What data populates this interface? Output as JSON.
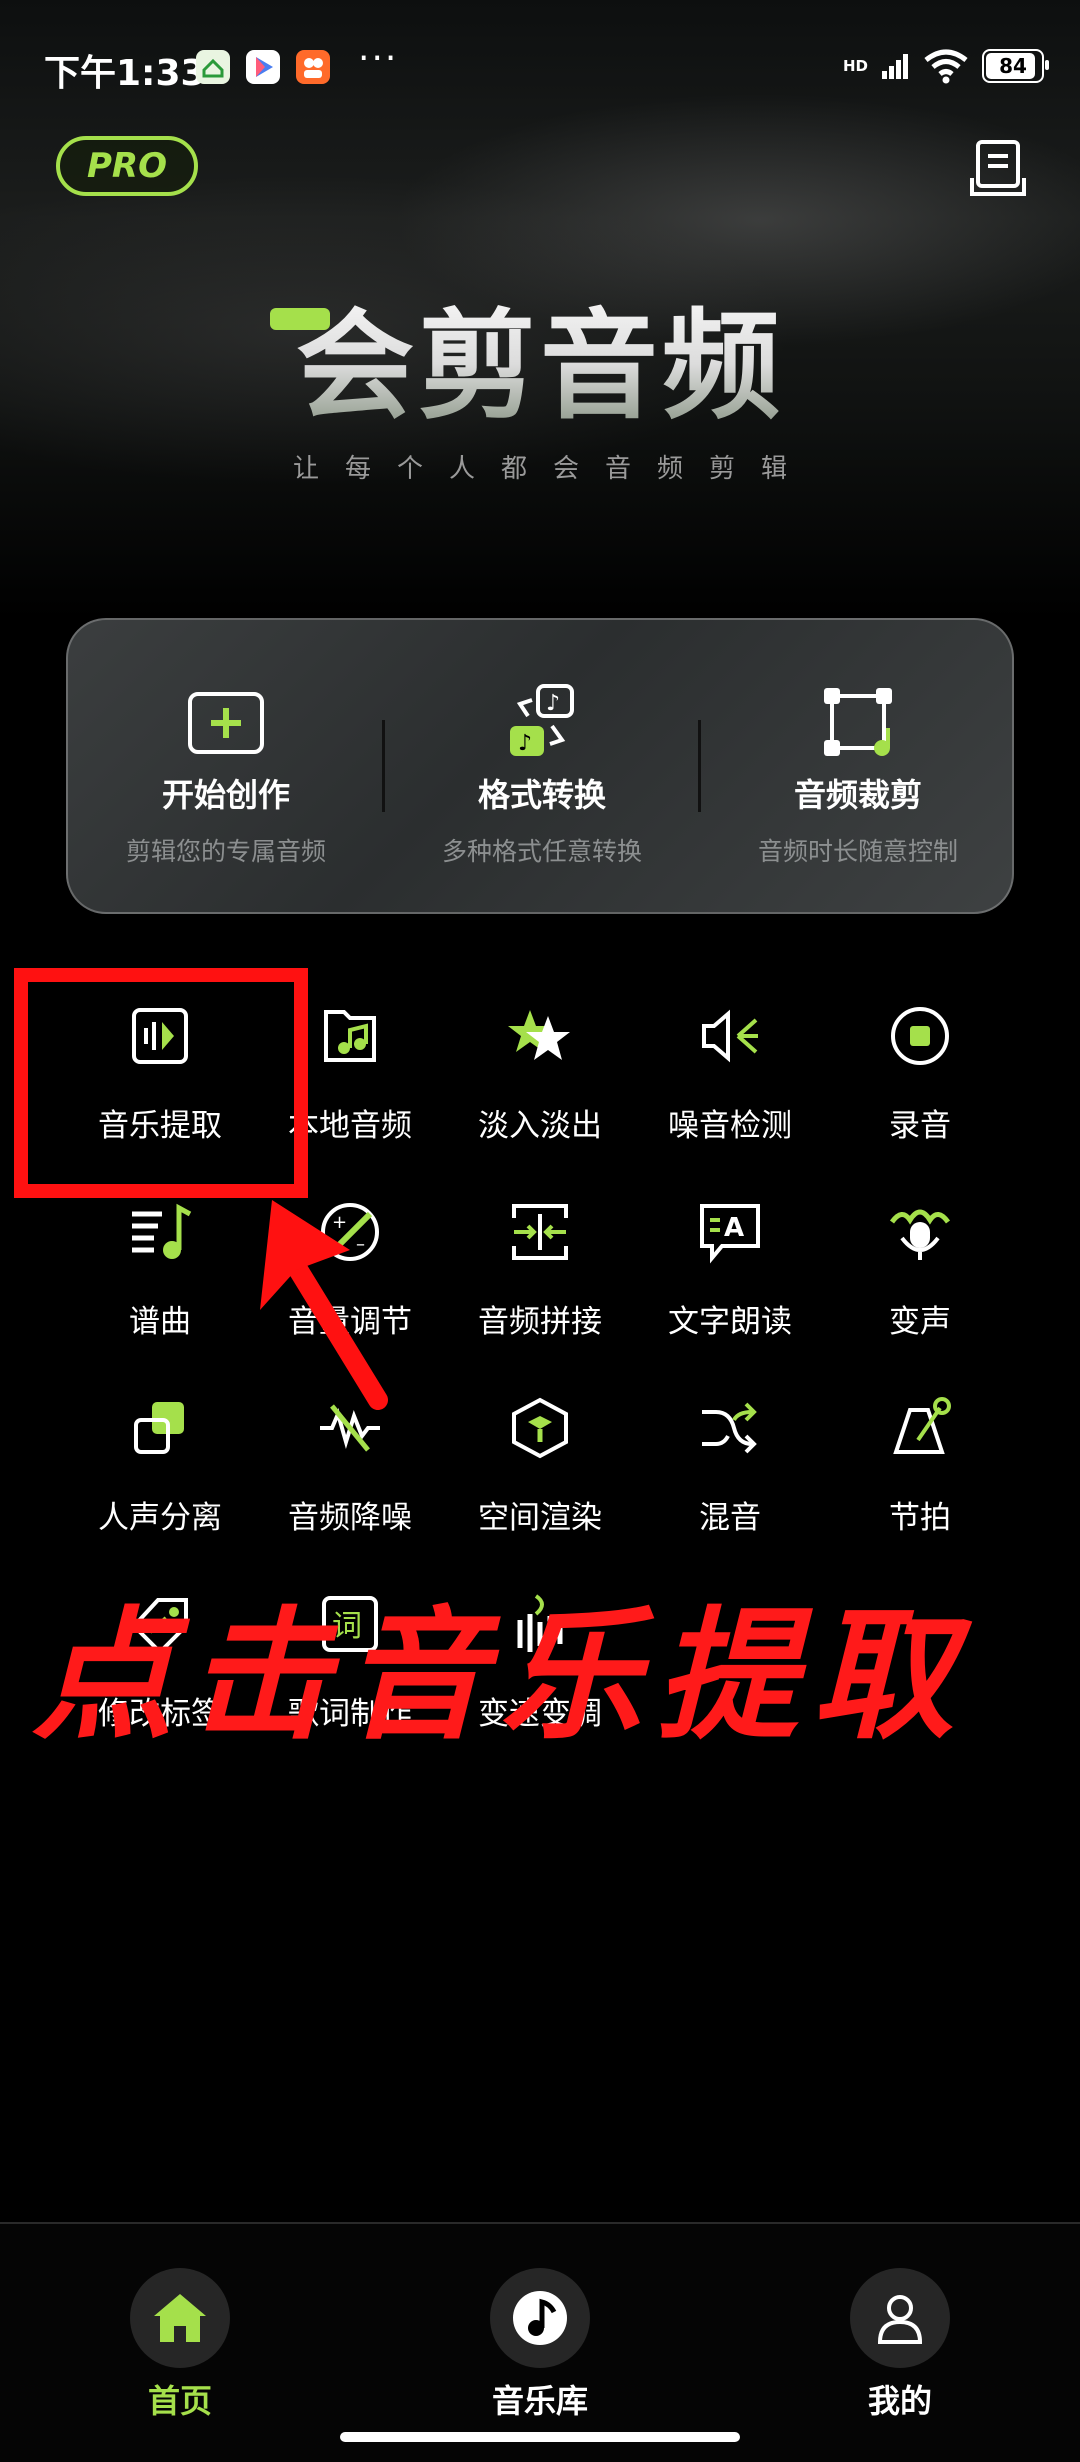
{
  "status_bar": {
    "time": "下午1:33",
    "hd": "HD",
    "battery": "84",
    "battery_level_percent": 84,
    "more": "···"
  },
  "header": {
    "pro_badge": "PRO",
    "title": "会剪音频",
    "subtitle": "让每个人都会音频剪辑"
  },
  "feature_card": [
    {
      "title": "开始创作",
      "desc": "剪辑您的专属音频",
      "icon": "add-square-icon"
    },
    {
      "title": "格式转换",
      "desc": "多种格式任意转换",
      "icon": "convert-icon"
    },
    {
      "title": "音频裁剪",
      "desc": "音频时长随意控制",
      "icon": "crop-icon"
    }
  ],
  "tools": [
    {
      "label": "音乐提取",
      "icon": "music-extract-icon"
    },
    {
      "label": "本地音频",
      "icon": "local-folder-icon"
    },
    {
      "label": "淡入淡出",
      "icon": "star-fade-icon"
    },
    {
      "label": "噪音检测",
      "icon": "noise-detect-icon"
    },
    {
      "label": "录音",
      "icon": "record-icon"
    },
    {
      "label": "谱曲",
      "icon": "compose-icon"
    },
    {
      "label": "音量调节",
      "icon": "volume-adjust-icon"
    },
    {
      "label": "音频拼接",
      "icon": "audio-join-icon"
    },
    {
      "label": "文字朗读",
      "icon": "text-to-speech-icon"
    },
    {
      "label": "变声",
      "icon": "voice-changer-icon"
    },
    {
      "label": "人声分离",
      "icon": "vocal-separate-icon"
    },
    {
      "label": "音频降噪",
      "icon": "denoise-icon"
    },
    {
      "label": "空间渲染",
      "icon": "spatial-cube-icon"
    },
    {
      "label": "混音",
      "icon": "shuffle-mix-icon"
    },
    {
      "label": "节拍",
      "icon": "metronome-icon"
    },
    {
      "label": "修改标签",
      "icon": "tag-icon"
    },
    {
      "label": "歌词制作",
      "icon": "lyrics-icon"
    },
    {
      "label": "变速变调",
      "icon": "speed-pitch-icon"
    }
  ],
  "annotation": {
    "text": "点击音乐提取"
  },
  "bottom_nav": [
    {
      "label": "首页",
      "icon": "home-icon",
      "active": true
    },
    {
      "label": "音乐库",
      "icon": "music-note-icon",
      "active": false
    },
    {
      "label": "我的",
      "icon": "profile-icon",
      "active": false
    }
  ],
  "colors": {
    "accent": "#a5e04b",
    "background": "#000000",
    "card": "#333637",
    "annotation": "#ff1111"
  }
}
